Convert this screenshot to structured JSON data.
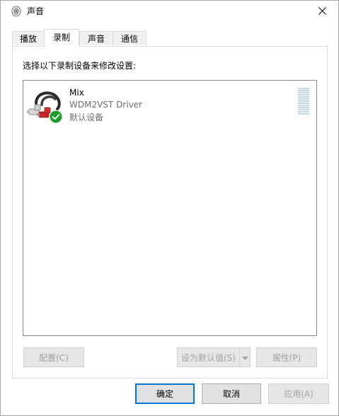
{
  "window": {
    "title": "声音",
    "title_icon": "speaker-icon",
    "close_icon": "close-icon"
  },
  "tabs": [
    {
      "label": "播放",
      "active": false
    },
    {
      "label": "录制",
      "active": true
    },
    {
      "label": "声音",
      "active": false
    },
    {
      "label": "通信",
      "active": false
    }
  ],
  "recording": {
    "instruction": "选择以下录制设备来修改设置:",
    "devices": [
      {
        "name": "Mix",
        "description": "WDM2VST Driver",
        "status": "默认设备",
        "icon": "rca-cable-icon",
        "badge_icon": "default-check-icon",
        "badge_color": "#1a9e2b",
        "level": 0
      }
    ],
    "buttons": {
      "configure": "配置(C)",
      "set_default": "设为默认值(S)",
      "properties": "属性(P)"
    }
  },
  "dialog_buttons": {
    "ok": "确定",
    "cancel": "取消",
    "apply": "应用(A)"
  },
  "colors": {
    "accent": "#0078d7",
    "meter": "#bfd9ea",
    "disabled_text": "#a2a2a2"
  }
}
